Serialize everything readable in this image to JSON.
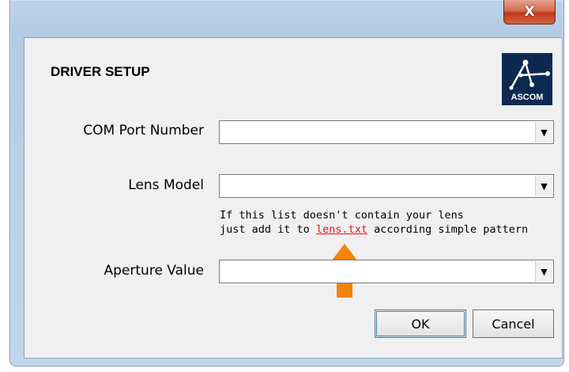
{
  "window": {
    "close_glyph": "X"
  },
  "dialog": {
    "heading": "DRIVER SETUP",
    "logo_text": "ASCOM",
    "fields": [
      {
        "label": "COM Port Number",
        "value": ""
      },
      {
        "label": "Lens Model",
        "value": ""
      },
      {
        "label": "Aperture Value",
        "value": ""
      }
    ],
    "hint": {
      "line1": "If this list doesn't contain your lens",
      "line2_pre": "just add it to",
      "link": "lens.txt",
      "line2_post": "according simple pattern"
    },
    "buttons": {
      "ok": "OK",
      "cancel": "Cancel"
    }
  },
  "colors": {
    "link": "#e8101a",
    "arrow": "#f5820d",
    "logo_bg": "#0c2a50"
  },
  "icons": [
    "close-icon",
    "ascom-logo",
    "dropdown-arrow-icon",
    "pointer-arrow-icon"
  ]
}
